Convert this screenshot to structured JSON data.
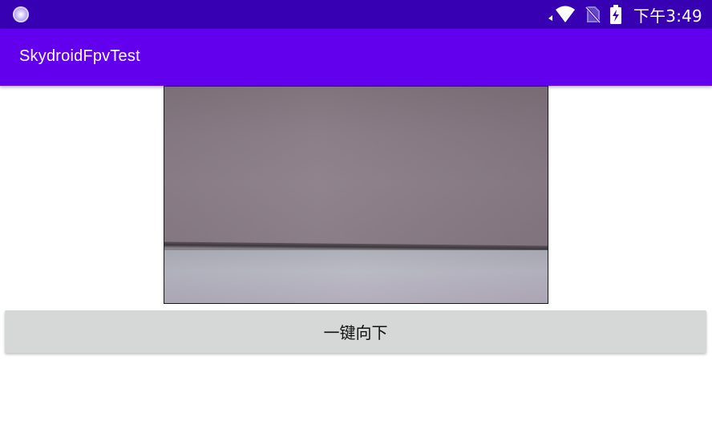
{
  "status_bar": {
    "background": "#3700b3",
    "left_icon": "app-notification-icon",
    "icons": [
      "wifi-icon",
      "no-sim-icon",
      "battery-charging-icon"
    ],
    "time": "下午3:49"
  },
  "app_bar": {
    "background": "#6200ee",
    "title": "SkydroidFpvTest"
  },
  "video_preview": {
    "content": "camera-feed"
  },
  "actions": {
    "down_button_label": "一键向下",
    "button_color": "#d6d7d7"
  }
}
